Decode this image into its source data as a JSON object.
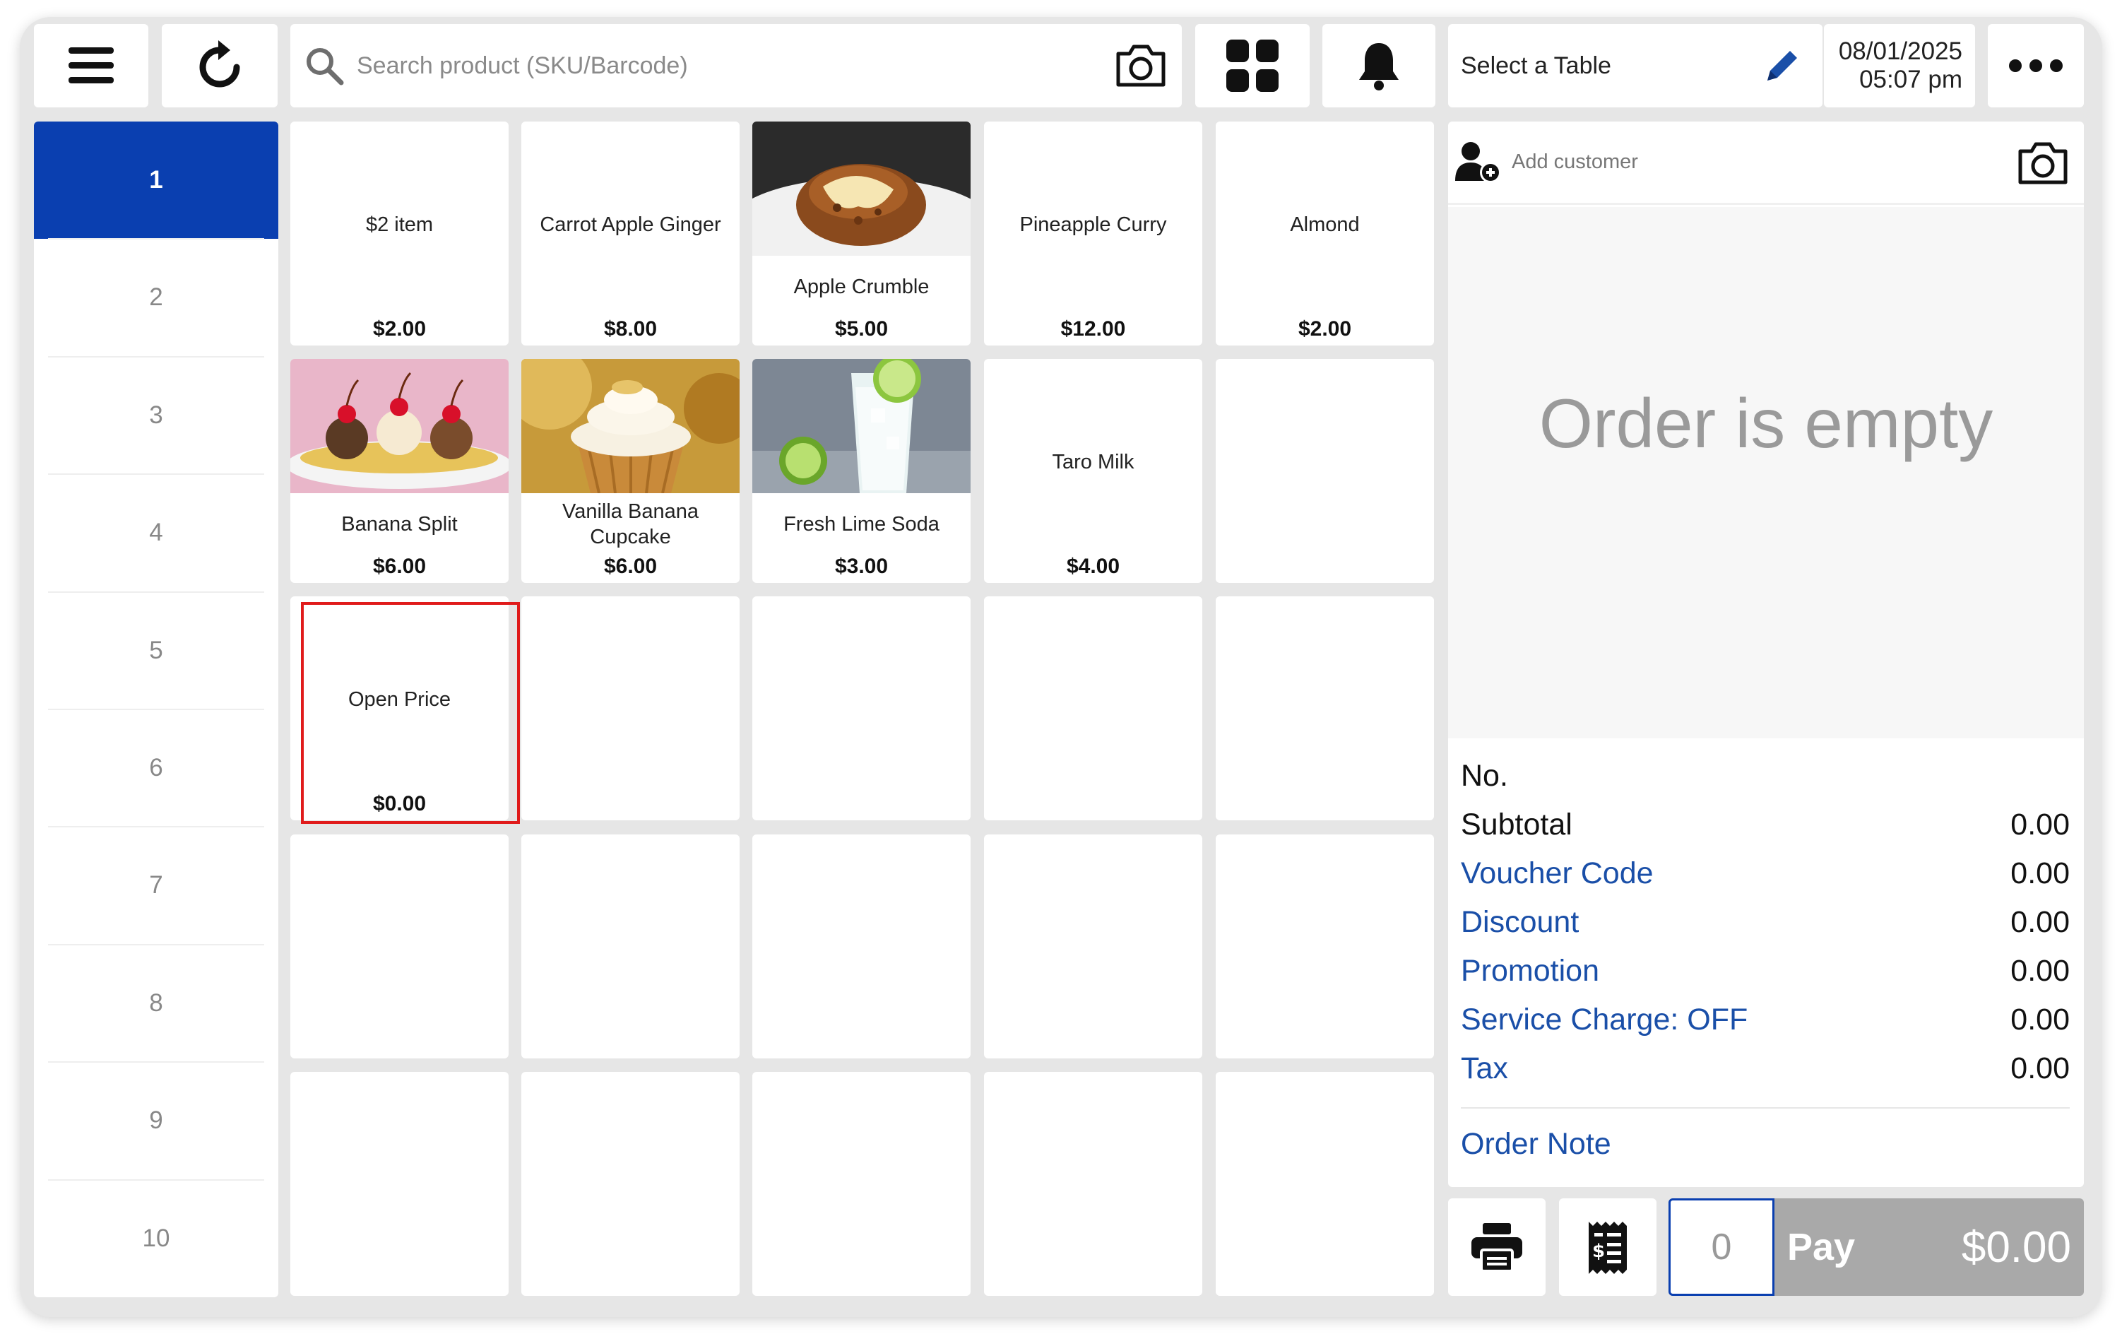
{
  "toolbar": {
    "search_placeholder": "Search product (SKU/Barcode)",
    "table_label": "Select a Table",
    "date": "08/01/2025",
    "time": "05:07 pm"
  },
  "sidebar": {
    "pages": [
      "1",
      "2",
      "3",
      "4",
      "5",
      "6",
      "7",
      "8",
      "9",
      "10"
    ],
    "active_index": 0
  },
  "products": [
    {
      "name": "$2 item",
      "price": "$2.00",
      "image": ""
    },
    {
      "name": "Carrot Apple Ginger",
      "price": "$8.00",
      "image": ""
    },
    {
      "name": "Apple Crumble",
      "price": "$5.00",
      "image": "apple-crumble-photo"
    },
    {
      "name": "Pineapple Curry",
      "price": "$12.00",
      "image": ""
    },
    {
      "name": "Almond",
      "price": "$2.00",
      "image": ""
    },
    {
      "name": "Banana Split",
      "price": "$6.00",
      "image": "banana-split-photo"
    },
    {
      "name": "Vanilla Banana Cupcake",
      "price": "$6.00",
      "image": "cupcake-photo"
    },
    {
      "name": "Fresh Lime Soda",
      "price": "$3.00",
      "image": "lime-soda-photo"
    },
    {
      "name": "Taro Milk",
      "price": "$4.00",
      "image": ""
    },
    {
      "name": "",
      "price": "",
      "image": ""
    },
    {
      "name": "Open Price",
      "price": "$0.00",
      "image": ""
    }
  ],
  "order": {
    "add_customer": "Add customer",
    "empty_text": "Order is empty",
    "no_label": "No.",
    "rows": [
      {
        "label": "Subtotal",
        "value": "0.00",
        "link": false
      },
      {
        "label": "Voucher Code",
        "value": "0.00",
        "link": true
      },
      {
        "label": "Discount",
        "value": "0.00",
        "link": true
      },
      {
        "label": "Promotion",
        "value": "0.00",
        "link": true
      },
      {
        "label": "Service Charge: OFF",
        "value": "0.00",
        "link": true
      },
      {
        "label": "Tax",
        "value": "0.00",
        "link": true
      }
    ],
    "order_note": "Order Note"
  },
  "footer": {
    "quantity": "0",
    "pay_label": "Pay",
    "pay_amount": "$0.00"
  },
  "colors": {
    "accent": "#0a3fb0",
    "link": "#1a4fa8",
    "highlight": "#e01b1b",
    "pay_disabled": "#a9a9a9"
  }
}
